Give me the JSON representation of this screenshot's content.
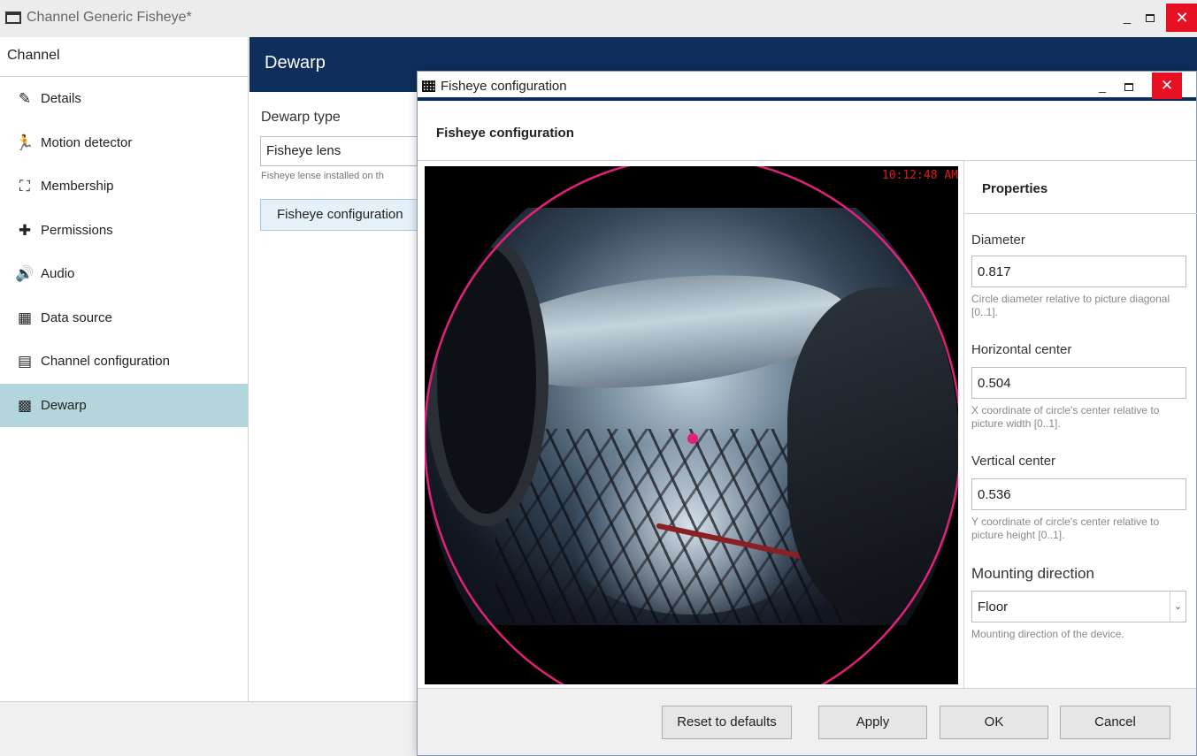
{
  "window": {
    "title": "Channel Generic Fisheye*",
    "minimize": "_",
    "close": "✕"
  },
  "sidebar": {
    "header": "Channel",
    "items": [
      {
        "label": "Details",
        "icon": "pencil-icon",
        "glyph": "✎"
      },
      {
        "label": "Motion detector",
        "icon": "running-man-icon",
        "glyph": "🏃"
      },
      {
        "label": "Membership",
        "icon": "group-icon",
        "glyph": "⛶"
      },
      {
        "label": "Permissions",
        "icon": "puzzle-icon",
        "glyph": "✚"
      },
      {
        "label": "Audio",
        "icon": "speaker-icon",
        "glyph": "🔊"
      },
      {
        "label": "Data source",
        "icon": "data-source-icon",
        "glyph": "▦"
      },
      {
        "label": "Channel configuration",
        "icon": "channel-config-icon",
        "glyph": "▤"
      },
      {
        "label": "Dewarp",
        "icon": "dewarp-icon",
        "glyph": "▩"
      }
    ],
    "active_index": 7
  },
  "content": {
    "title": "Dewarp",
    "dewarp_type_label": "Dewarp type",
    "dewarp_type_value": "Fisheye lens",
    "dewarp_hint": "Fisheye lense installed on th",
    "fisheye_config_button": "Fisheye configuration"
  },
  "dialog": {
    "title": "Fisheye configuration",
    "heading": "Fisheye configuration",
    "minimize": "_",
    "close": "✕",
    "preview": {
      "timestamp": "10:12:48 AM"
    },
    "properties": {
      "heading": "Properties",
      "diameter": {
        "label": "Diameter",
        "value": "0.817",
        "hint": "Circle diameter relative to picture diagonal [0..1]."
      },
      "horizontal_center": {
        "label": "Horizontal center",
        "value": "0.504",
        "hint": "X coordinate of circle's center relative to picture width [0..1]."
      },
      "vertical_center": {
        "label": "Vertical center",
        "value": "0.536",
        "hint": "Y coordinate of circle's center relative to picture height [0..1]."
      },
      "mounting_direction": {
        "label": "Mounting direction",
        "value": "Floor",
        "hint": "Mounting direction of the device."
      }
    },
    "buttons": {
      "reset": "Reset to defaults",
      "apply": "Apply",
      "ok": "OK",
      "cancel": "Cancel"
    }
  },
  "colors": {
    "accent": "#0e2f5c",
    "active_item": "#b3d6dd",
    "close_red": "#e81123",
    "circle": "#e0217a",
    "timestamp": "#e21a1a"
  }
}
